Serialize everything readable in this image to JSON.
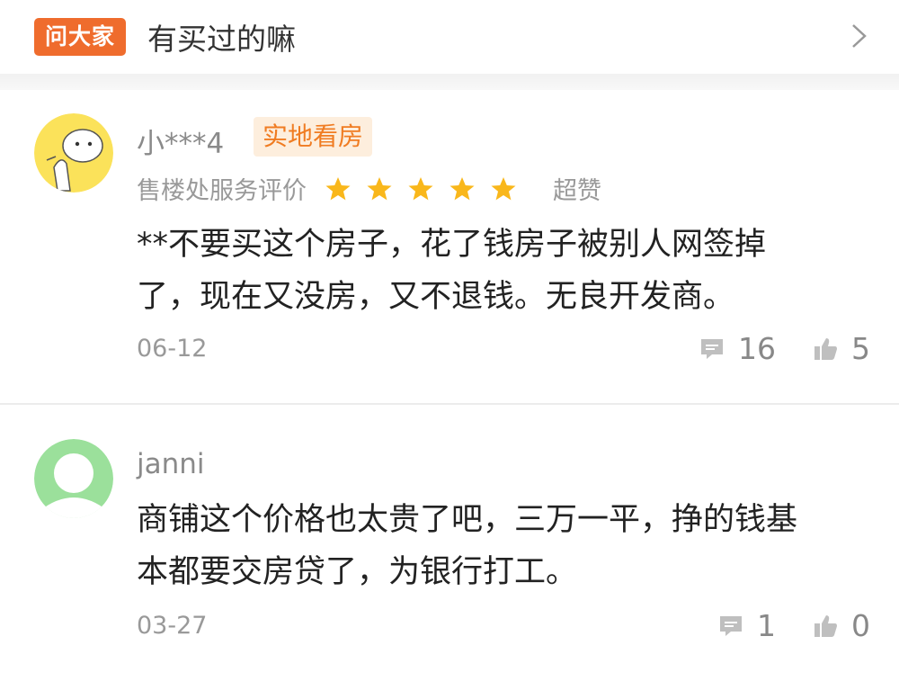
{
  "ask": {
    "badge": "问大家",
    "question": "有买过的嘛"
  },
  "reviews": [
    {
      "username": "小***4",
      "tag": "实地看房",
      "rating_label": "售楼处服务评价",
      "rating": 5,
      "rating_max": 5,
      "rating_word": "超赞",
      "text_line1": "**不要买这个房子，花了钱房子被别人网签掉",
      "text_line2": "了，现在又没房，又不退钱。无良开发商。",
      "date": "06-12",
      "comments": "16",
      "likes": "5"
    },
    {
      "username": "janni",
      "text_line1": "商铺这个价格也太贵了吧，三万一平，挣的钱基",
      "text_line2": "本都要交房贷了，为银行打工。",
      "date": "03-27",
      "comments": "1",
      "likes": "0"
    }
  ],
  "colors": {
    "accent": "#ef6c2d",
    "star": "#f9b71b",
    "tag_bg": "#fdeedd",
    "tag_text": "#f07c22",
    "default_avatar": "#9be09b"
  }
}
